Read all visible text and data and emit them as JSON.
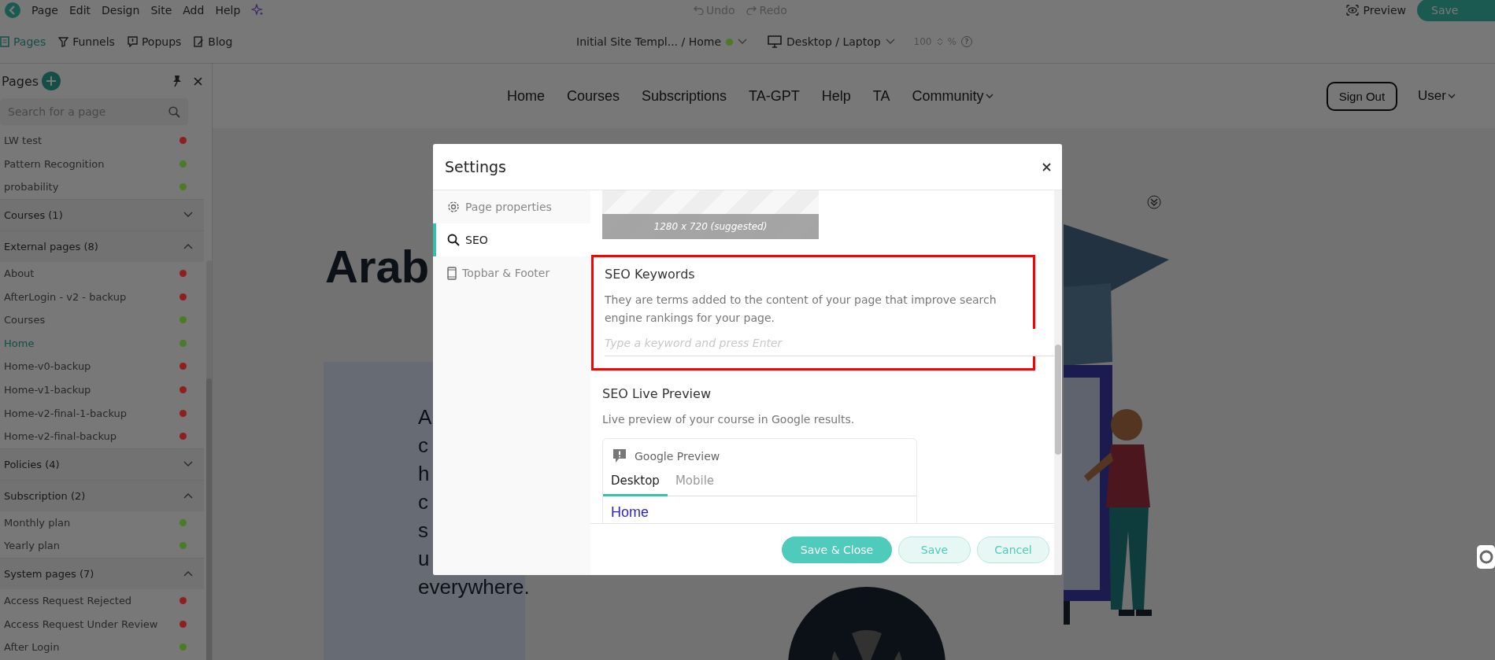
{
  "menu": [
    "Page",
    "Edit",
    "Design",
    "Site",
    "Add",
    "Help"
  ],
  "history": [
    {
      "label": "Undo",
      "disabled": true
    },
    {
      "label": "Redo",
      "disabled": true
    }
  ],
  "preview": "Preview",
  "save": "Save",
  "tabs": [
    {
      "label": "Pages",
      "selected": true
    },
    {
      "label": "Funnels",
      "selected": false
    },
    {
      "label": "Popups",
      "selected": false
    },
    {
      "label": "Blog",
      "selected": false
    }
  ],
  "page_selector": {
    "label": "Initial Site Templ... / Home",
    "color": "#4d7a26"
  },
  "device": "Desktop / Laptop",
  "zoom": {
    "value": "100",
    "unit": "%",
    "help": "?"
  },
  "sidebar": {
    "title": "Pages",
    "search_placeholder": "Search for a page",
    "items": [
      {
        "label": "LW test",
        "selected": false,
        "color": "#8e1f1f"
      },
      {
        "label": "Pattern Recognition",
        "selected": false,
        "color": "#4d7a26"
      },
      {
        "label": "probability",
        "selected": false,
        "color": "#4d7a26"
      }
    ],
    "groups": [
      {
        "title": "Courses (1)",
        "expanded": false
      },
      {
        "title": "External pages (8)",
        "expanded": true,
        "items": [
          {
            "label": "About",
            "selected": false,
            "color": "#8e1f1f"
          },
          {
            "label": "AfterLogin - v2 - backup",
            "selected": false,
            "color": "#8e1f1f"
          },
          {
            "label": "Courses",
            "selected": false,
            "color": "#4d7a26"
          },
          {
            "label": "Home",
            "selected": true,
            "color": "#4d7a26"
          },
          {
            "label": "Home-v0-backup",
            "selected": false,
            "color": "#8e1f1f"
          },
          {
            "label": "Home-v1-backup",
            "selected": false,
            "color": "#8e1f1f"
          },
          {
            "label": "Home-v2-final-1-backup",
            "selected": false,
            "color": "#8e1f1f"
          },
          {
            "label": "Home-v2-final-backup",
            "selected": false,
            "color": "#8e1f1f"
          }
        ]
      },
      {
        "title": "Policies (4)",
        "expanded": false
      },
      {
        "title": "Subscription (2)",
        "expanded": true,
        "items": [
          {
            "label": "Monthly plan",
            "selected": false,
            "color": "#4d7a26"
          },
          {
            "label": "Yearly plan",
            "selected": false,
            "color": "#4d7a26"
          }
        ]
      },
      {
        "title": "System pages (7)",
        "expanded": true,
        "items": [
          {
            "label": "Access Request Rejected",
            "selected": false,
            "color": "#8e1f1f"
          },
          {
            "label": "Access Request Under Review",
            "selected": false,
            "color": "#8e1f1f"
          },
          {
            "label": "After Login",
            "selected": false,
            "color": "#4d7a26"
          }
        ]
      }
    ]
  },
  "site_nav": [
    "Home",
    "Courses",
    "Subscriptions",
    "TA-GPT",
    "Help",
    "TA",
    "Community"
  ],
  "sign_out": "Sign Out",
  "user": "User",
  "hero": {
    "heading": "Arab",
    "lines": [
      "A",
      "c",
      "h",
      "c",
      "s",
      "u",
      "everywhere."
    ]
  },
  "modal": {
    "title": "Settings",
    "nav": [
      {
        "label": "Page properties",
        "selected": false
      },
      {
        "label": "SEO",
        "selected": true
      },
      {
        "label": "Topbar & Footer",
        "selected": false
      }
    ],
    "image_hint": "1280 x 720 (suggested)",
    "keywords": {
      "title": "SEO Keywords",
      "description": "They are terms added to the content of your page that improve search engine rankings for your page.",
      "placeholder": "Type a keyword and press Enter",
      "highlighted": true
    },
    "live_preview": {
      "title": "SEO Live Preview",
      "description": "Live preview of your course in Google results.",
      "card_title": "Google Preview",
      "tabs": [
        {
          "label": "Desktop",
          "selected": true
        },
        {
          "label": "Mobile",
          "selected": false
        }
      ],
      "result_title": "Home"
    },
    "buttons": [
      {
        "label": "Save & Close",
        "kind": "primary"
      },
      {
        "label": "Save",
        "kind": "secondary"
      },
      {
        "label": "Cancel",
        "kind": "secondary"
      }
    ]
  }
}
